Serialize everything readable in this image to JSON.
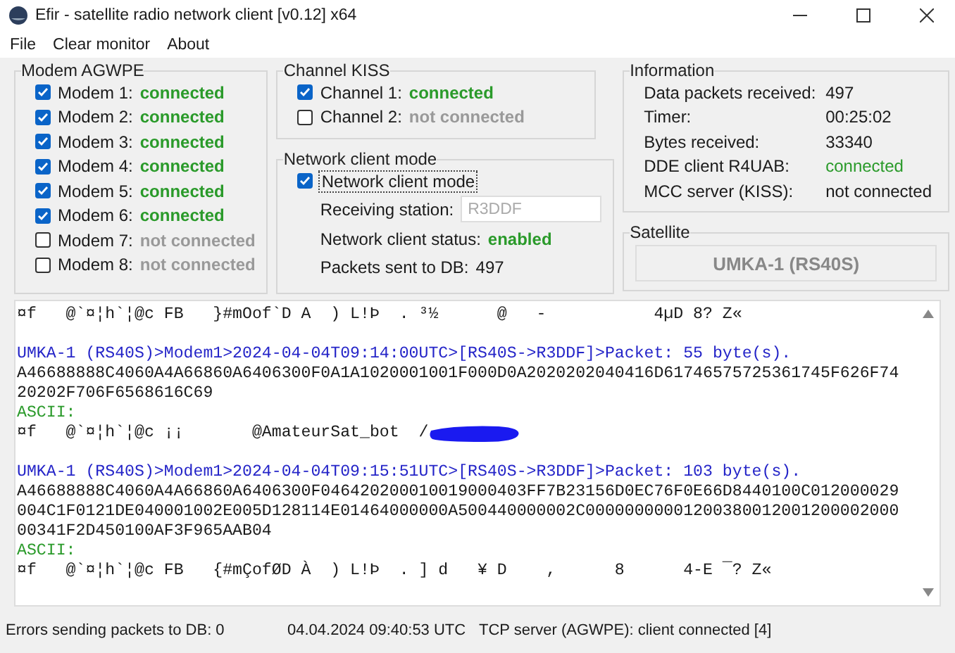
{
  "window": {
    "title": "Efir - satellite radio network client [v0.12] x64"
  },
  "menu": [
    "File",
    "Clear monitor",
    "About"
  ],
  "modem_group": {
    "title": "Modem AGWPE",
    "items": [
      {
        "label": "Modem 1:",
        "status": "connected",
        "checked": true
      },
      {
        "label": "Modem 2:",
        "status": "connected",
        "checked": true
      },
      {
        "label": "Modem 3:",
        "status": "connected",
        "checked": true
      },
      {
        "label": "Modem 4:",
        "status": "connected",
        "checked": true
      },
      {
        "label": "Modem 5:",
        "status": "connected",
        "checked": true
      },
      {
        "label": "Modem 6:",
        "status": "connected",
        "checked": true
      },
      {
        "label": "Modem 7:",
        "status": "not connected",
        "checked": false
      },
      {
        "label": "Modem 8:",
        "status": "not connected",
        "checked": false
      }
    ]
  },
  "kiss_group": {
    "title": "Channel KISS",
    "items": [
      {
        "label": "Channel 1:",
        "status": "connected",
        "checked": true
      },
      {
        "label": "Channel 2:",
        "status": "not connected",
        "checked": false
      }
    ]
  },
  "network_group": {
    "title": "Network client mode",
    "checkbox": {
      "label": "Network client mode",
      "checked": true
    },
    "receiving_station": {
      "label": "Receiving station:",
      "placeholder": "R3DDF"
    },
    "client_status": {
      "label": "Network client status:",
      "value": "enabled"
    },
    "packets_sent": {
      "label": "Packets sent to DB:",
      "value": "497"
    }
  },
  "info_group": {
    "title": "Information",
    "rows": [
      {
        "label": "Data packets received:",
        "value": "497",
        "highlight": false
      },
      {
        "label": "Timer:",
        "value": "00:25:02",
        "highlight": false
      },
      {
        "label": "Bytes received:",
        "value": "33340",
        "highlight": false
      },
      {
        "label": "DDE client R4UAB:",
        "value": "connected",
        "highlight": true
      },
      {
        "label": "MCC server (KISS):",
        "value": "not connected",
        "highlight": false
      }
    ]
  },
  "satellite_group": {
    "title": "Satellite",
    "name": "UMKA-1 (RS40S)"
  },
  "monitor": {
    "lines": [
      {
        "kind": "raw",
        "text": "¤f   @`¤¦h`¦@c FB   }#mOof`D A  ) L!Þ  . ³½      @   -           4µD 8? Z«"
      },
      {
        "kind": "blank"
      },
      {
        "kind": "header",
        "text": "UMKA-1 (RS40S)>Modem1>2024-04-04T09:14:00UTC>[RS40S->R3DDF]>Packet: 55 byte(s)."
      },
      {
        "kind": "hex",
        "text": "A46688888C4060A4A66860A6406300F0A1A1020001001F000D0A2020202040416D61746575725361745F626F74"
      },
      {
        "kind": "hex",
        "text": "20202F706F6568616C69"
      },
      {
        "kind": "label",
        "text": "ASCII:"
      },
      {
        "kind": "raw",
        "text": "¤f   @`¤¦h`¦@c ¡¡       @AmateurSat_bot  /",
        "redacted": true
      },
      {
        "kind": "blank"
      },
      {
        "kind": "header",
        "text": "UMKA-1 (RS40S)>Modem1>2024-04-04T09:15:51UTC>[RS40S->R3DDF]>Packet: 103 byte(s)."
      },
      {
        "kind": "hex",
        "text": "A46688888C4060A4A66860A6406300F046420200010019000403FF7B23156D0EC76F0E66D8440100C012000029"
      },
      {
        "kind": "hex",
        "text": "004C1F0121DE040001002E005D128114E01464000000A500440000002C00000000001200380012001200002000"
      },
      {
        "kind": "hex",
        "text": "00341F2D450100AF3F965AAB04"
      },
      {
        "kind": "label",
        "text": "ASCII:"
      },
      {
        "kind": "raw",
        "text": "¤f   @`¤¦h`¦@c FB   {#mÇofØD À  ) L!Þ  . ] d   ¥ D    ,      8      4-E ¯? Z«"
      }
    ]
  },
  "status_bar": [
    "Errors sending packets to DB: 0",
    "04.04.2024 09:40:53 UTC",
    "TCP server (AGWPE): client connected [4]"
  ]
}
